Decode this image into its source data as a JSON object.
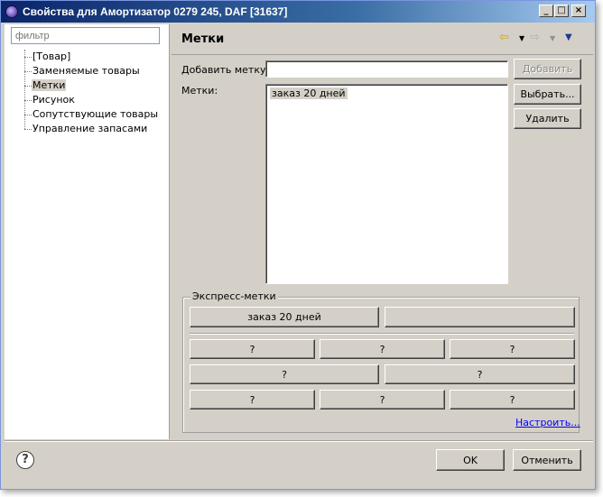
{
  "window": {
    "title": "Свойства для Амортизатор 0279 245, DAF [31637]",
    "min_glyph": "_",
    "max_glyph": "□",
    "close_glyph": "×"
  },
  "left": {
    "filter_placeholder": "фильтр",
    "tree": [
      {
        "label": "[Товар]",
        "selected": false
      },
      {
        "label": "Заменяемые товары",
        "selected": false
      },
      {
        "label": "Метки",
        "selected": true
      },
      {
        "label": "Рисунок",
        "selected": false
      },
      {
        "label": "Сопутствующие товары",
        "selected": false
      },
      {
        "label": "Управление запасами",
        "selected": false
      }
    ]
  },
  "right": {
    "title": "Метки",
    "nav": {
      "back": "⇦",
      "dropdown": "▼",
      "forward": "⇨",
      "menu": "▼"
    },
    "add_tag_label": "Добавить метку:",
    "add_tag_value": "",
    "add_button": "Добавить",
    "tags_label": "Метки:",
    "tags": [
      "заказ 20 дней"
    ],
    "select_button": "Выбрать...",
    "delete_button": "Удалить",
    "express": {
      "title": "Экспресс-метки",
      "top_row": [
        "заказ 20 дней",
        ""
      ],
      "row1": [
        "?",
        "?",
        "?"
      ],
      "row2": [
        "?",
        "?"
      ],
      "row3": [
        "?",
        "?",
        "?"
      ],
      "configure_link": "Настроить..."
    }
  },
  "footer": {
    "help": "?",
    "ok": "OK",
    "cancel": "Отменить"
  },
  "colors": {
    "dialog_bg": "#d4d0c8",
    "title_gradient_start": "#0a246a",
    "link": "#0000ff"
  }
}
